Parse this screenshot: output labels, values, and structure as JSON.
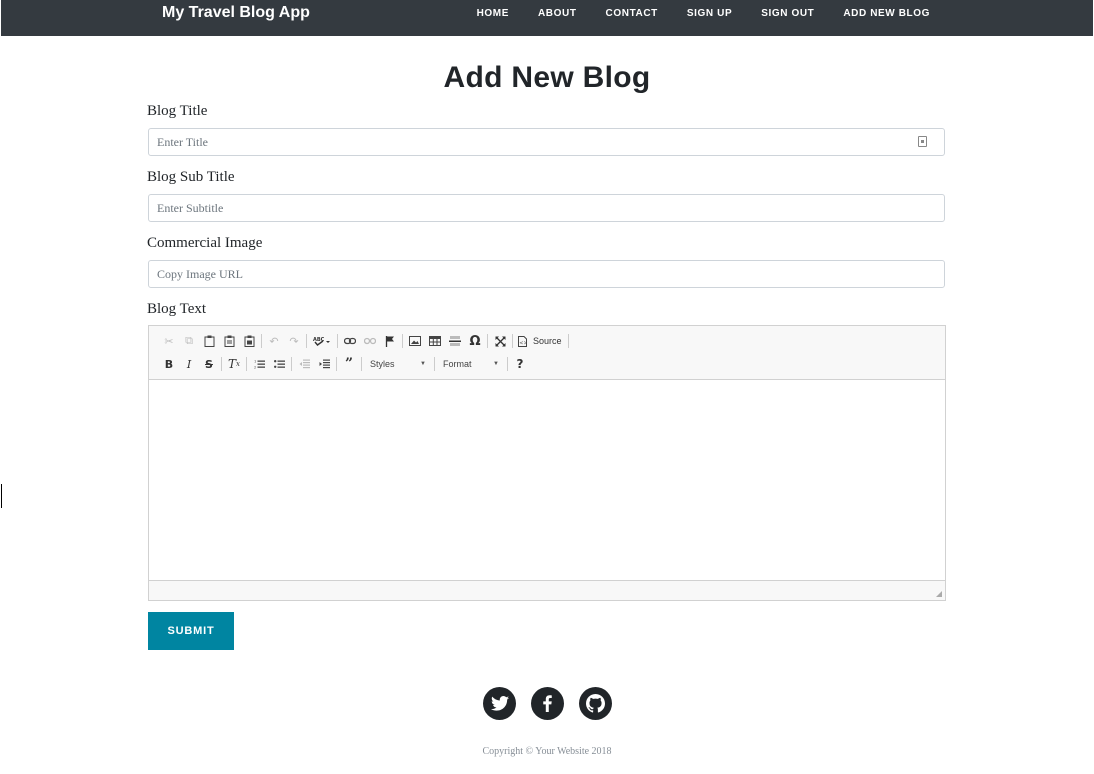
{
  "navbar": {
    "brand": "My Travel Blog App",
    "links": [
      "HOME",
      "ABOUT",
      "CONTACT",
      "SIGN UP",
      "SIGN OUT",
      "ADD NEW BLOG"
    ]
  },
  "page": {
    "title": "Add New Blog"
  },
  "form": {
    "title_label": "Blog Title",
    "title_placeholder": "Enter Title",
    "title_value": "",
    "subtitle_label": "Blog Sub Title",
    "subtitle_placeholder": "Enter Subtitle",
    "subtitle_value": "",
    "image_label": "Commercial Image",
    "image_placeholder": "Copy Image URL",
    "image_value": "",
    "text_label": "Blog Text",
    "submit_label": "SUBMIT"
  },
  "editor": {
    "source_label": "Source",
    "styles_label": "Styles",
    "format_label": "Format",
    "help_label": "?"
  },
  "footer": {
    "social": [
      "twitter-icon",
      "facebook-icon",
      "github-icon"
    ],
    "copyright": "Copyright © Your Website 2018"
  },
  "colors": {
    "navbar_bg": "#343a40",
    "accent": "#0085a1",
    "social_bg": "#212529"
  }
}
